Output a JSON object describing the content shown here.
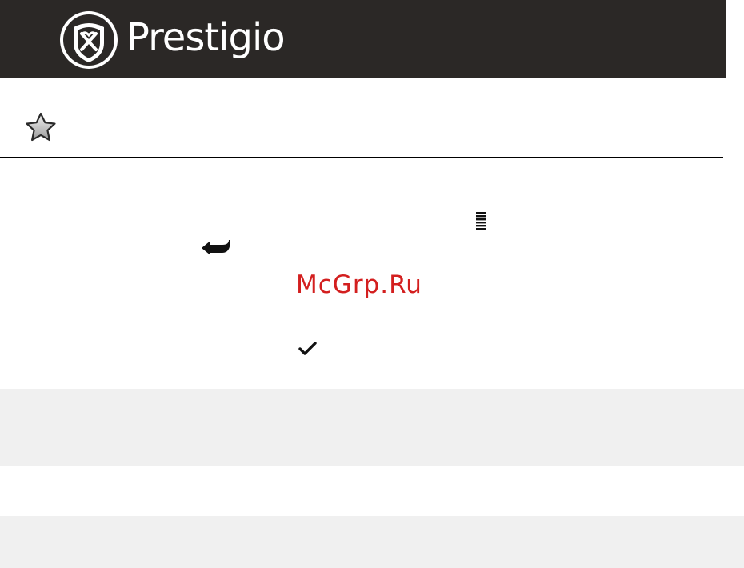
{
  "header": {
    "brand_name": "Prestigio",
    "background_color": "#2b2826",
    "logo_icon": "prestigio-shield-emblem-icon"
  },
  "section": {
    "marker_icon": "star-icon",
    "rule_color": "#000000"
  },
  "content": {
    "icons": [
      "menu-icon",
      "back-arrow-icon",
      "checkmark-icon"
    ],
    "watermark": {
      "text": "McGrp.Ru",
      "color": "#d31f1f"
    },
    "band_color": "#f0f0f0"
  }
}
